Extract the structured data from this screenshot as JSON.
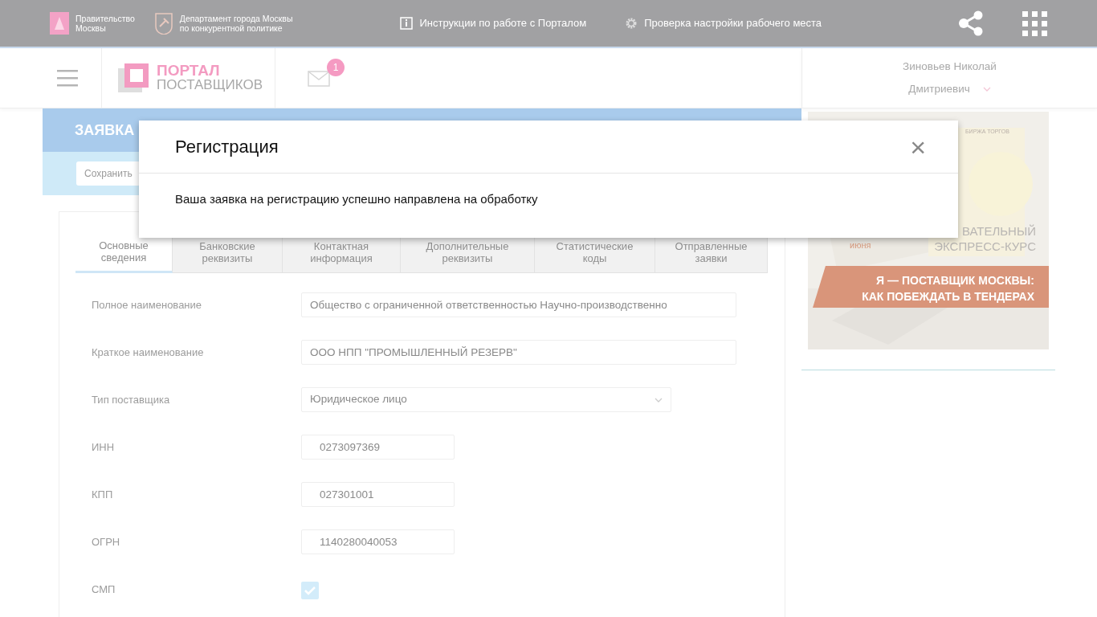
{
  "top_bar": {
    "orgs": [
      {
        "text": "Правительство\nМосквы"
      },
      {
        "text": "Департамент города Москвы\nпо конкурентной политике"
      }
    ],
    "links": [
      {
        "kind": "info",
        "text": "Инструкции по работе с Порталом"
      },
      {
        "kind": "settings",
        "text": "Проверка настройки рабочего места"
      }
    ]
  },
  "header": {
    "logo": {
      "line1": "ПОРТАЛ",
      "line2": "ПОСТАВЩИКОВ"
    },
    "messages_badge": "1",
    "user": {
      "line1": "Зиновьев Николай",
      "line2": "Дмитриевич"
    }
  },
  "page": {
    "title": "ЗАЯВКА",
    "save_button": "Сохранить"
  },
  "tabs": [
    {
      "label": "Основные\nсведения",
      "selected": true
    },
    {
      "label": "Банковские\nреквизиты",
      "selected": false
    },
    {
      "label": "Контактная\nинформация",
      "selected": false
    },
    {
      "label": "Дополнительные\nреквизиты",
      "selected": false
    },
    {
      "label": "Статистические\nкоды",
      "selected": false
    },
    {
      "label": "Отправленные\nзаявки",
      "selected": false
    }
  ],
  "fields": [
    {
      "kind": "name",
      "label": "Полное наименование",
      "value": "Общество с ограниченной ответственностью Научно-производственно"
    },
    {
      "kind": "name",
      "label": "Краткое наименование",
      "value": "ООО НПП \"ПРОМЫШЛЕННЫЙ РЕЗЕРВ\""
    },
    {
      "kind": "select",
      "label": "Тип поставщика",
      "value": "Юридическое лицо"
    },
    {
      "kind": "code",
      "label": "ИНН",
      "value": "0273097369"
    },
    {
      "kind": "code",
      "label": "КПП",
      "value": "027301001"
    },
    {
      "kind": "code",
      "label": "ОГРН",
      "value": "1140280040053"
    },
    {
      "kind": "checkbox",
      "label": "СМП",
      "checked": true
    }
  ],
  "banner": {
    "brand": "БИРЖА ТОРГОВ",
    "month": "июня",
    "course_1": "ВАТЕЛЬНЫЙ",
    "course_2": "ЭКСПРЕСС-КУРС",
    "headline_1": "Я — ПОСТАВЩИК МОСКВЫ:",
    "headline_2": "КАК ПОБЕЖДАТЬ В ТЕНДЕРАХ"
  },
  "modal": {
    "title": "Регистрация",
    "close": "×",
    "message": "Ваша заявка на регистрацию успешно направлена на обработку"
  }
}
